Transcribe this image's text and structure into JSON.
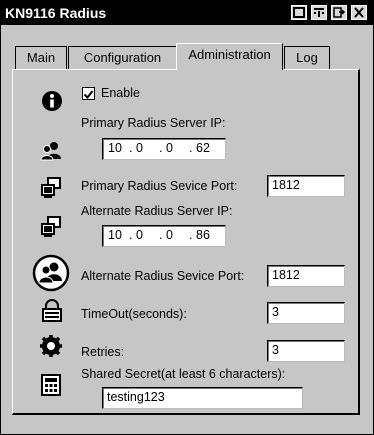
{
  "window": {
    "title": "KN9116 Radius"
  },
  "tabs": [
    {
      "label": "Main"
    },
    {
      "label": "Configuration"
    },
    {
      "label": "Administration"
    },
    {
      "label": "Log"
    }
  ],
  "form": {
    "enable_label": "Enable",
    "enable_checked": true,
    "primary_ip_label": "Primary Radius Server IP:",
    "primary_ip": [
      "10",
      "0",
      "0",
      "62"
    ],
    "primary_port_label": "Primary Radius Sevice Port:",
    "primary_port": "1812",
    "alt_ip_label": "Alternate Radius Server IP:",
    "alt_ip": [
      "10",
      "0",
      "0",
      "86"
    ],
    "alt_port_label": "Alternate Radius Sevice Port:",
    "alt_port": "1812",
    "timeout_label": "TimeOut(seconds):",
    "timeout": "3",
    "retries_label": "Retries:",
    "retries": "3",
    "secret_label": "Shared Secret(at least 6 characters):",
    "secret": "testing123"
  },
  "icons": [
    "info-icon",
    "users-icon",
    "server-port-icon",
    "alternate-server-icon",
    "user-circle-icon",
    "lock-icon",
    "gear-icon",
    "keypad-icon",
    "minimize-icon",
    "window-menu-icon",
    "exit-icon",
    "close-icon"
  ]
}
